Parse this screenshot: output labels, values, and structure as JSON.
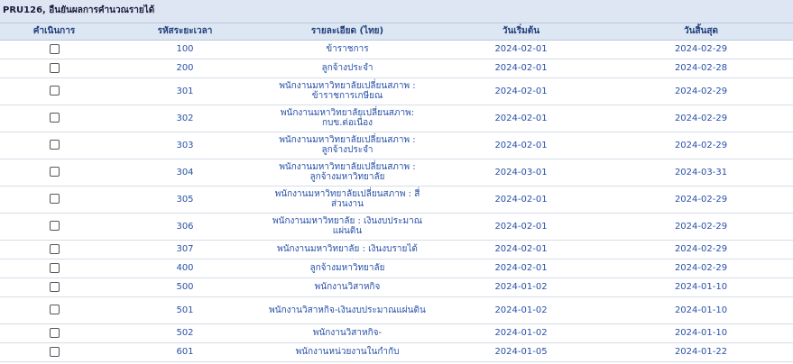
{
  "title": "PRU126, อืนยันผลการคำนวณรายได้",
  "columns": [
    "คำเนินการ",
    "รหัสระยะเวลา",
    "รายละเอียด (ไทย)",
    "วันเริ่มต้น",
    "วันสิ้นสุด"
  ],
  "rows": [
    {
      "code": "100",
      "desc": "ข้าราชการ",
      "start": "2024-02-01",
      "end": "2024-02-29",
      "checked": false
    },
    {
      "code": "200",
      "desc": "ลูกจ้างประจำ",
      "start": "2024-02-01",
      "end": "2024-02-28",
      "checked": false
    },
    {
      "code": "301",
      "desc": "พนักงานมหาวิทยาลัยเปลี่ยนสภาพ : ข้าราชการเกษียณ",
      "start": "2024-02-01",
      "end": "2024-02-29",
      "checked": false
    },
    {
      "code": "302",
      "desc": "พนักงานมหาวิทยาลัยเปลี่ยนสภาพ: กบข.ต่อเนื่อง",
      "start": "2024-02-01",
      "end": "2024-02-29",
      "checked": false
    },
    {
      "code": "303",
      "desc": "พนักงานมหาวิทยาลัยเปลี่ยนสภาพ : ลูกจ้างประจำ",
      "start": "2024-02-01",
      "end": "2024-02-29",
      "checked": false
    },
    {
      "code": "304",
      "desc": "พนักงานมหาวิทยาลัยเปลี่ยนสภาพ : ลูกจ้างมหาวิทยาลัย",
      "start": "2024-03-01",
      "end": "2024-03-31",
      "checked": false
    },
    {
      "code": "305",
      "desc": "พนักงานมหาวิทยาลัยเปลี่ยนสภาพ : สี่ส่วนงาน",
      "start": "2024-02-01",
      "end": "2024-02-29",
      "checked": false
    },
    {
      "code": "306",
      "desc": "พนักงานมหาวิทยาลัย : เงินงบประมาณแผ่นดิน",
      "start": "2024-02-01",
      "end": "2024-02-29",
      "checked": false
    },
    {
      "code": "307",
      "desc": "พนักงานมหาวิทยาลัย : เงินงบรายได้",
      "start": "2024-02-01",
      "end": "2024-02-29",
      "checked": false
    },
    {
      "code": "400",
      "desc": "ลูกจ้างมหาวิทยาลัย",
      "start": "2024-02-01",
      "end": "2024-02-29",
      "checked": false
    },
    {
      "code": "500",
      "desc": "พนักงานวิสาหกิจ",
      "start": "2024-01-02",
      "end": "2024-01-10",
      "checked": false
    },
    {
      "code": "501",
      "desc": "พนักงานวิสาหกิจ-เงินงบประมาณแผ่นดิน",
      "start": "2024-01-02",
      "end": "2024-01-10",
      "checked": false
    },
    {
      "code": "502",
      "desc": "พนักงานวิสาหกิจ-",
      "start": "2024-01-02",
      "end": "2024-01-10",
      "checked": false
    },
    {
      "code": "601",
      "desc": "พนักงานหน่วยงานในกำกับ",
      "start": "2024-01-05",
      "end": "2024-01-22",
      "checked": false
    }
  ]
}
